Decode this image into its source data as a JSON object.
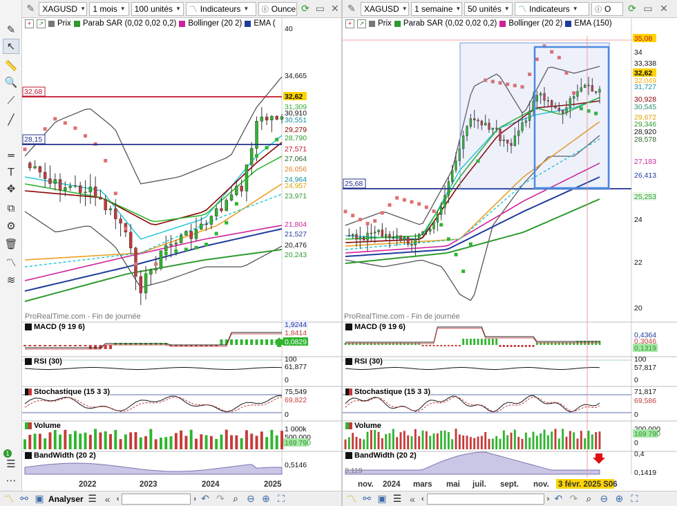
{
  "toolbar": {
    "tools": [
      "pencil-icon",
      "pointer-icon",
      "ruler-icon",
      "zoom-icon",
      "line-segment-icon",
      "trendline-icon",
      "hline-icon",
      "text-icon",
      "move-icon",
      "copy-icon",
      "settings-icon",
      "trash-icon",
      "indicator-icon",
      "fibonacci-icon"
    ],
    "badge": "1"
  },
  "left": {
    "symbol": "XAGUSD",
    "period": "1 mois",
    "units": "100 unités",
    "indicators_label": "Indicateurs",
    "unit_label": "Ounce",
    "legend": [
      "Prix",
      "Parab SAR (0,02 0,02 0,2)",
      "Bollinger (20 2)",
      "EMA ("
    ],
    "watermark": "ProRealTime.com - Fin de journée",
    "axis": [
      "40",
      "34,665",
      "32,62",
      "31,309",
      "30,910",
      "30,551",
      "29,279",
      "28,790",
      "27,571",
      "27,064",
      "26,056",
      "24,964",
      "24,957",
      "23,971",
      "21,804",
      "21,527",
      "20,476",
      "20,243"
    ],
    "hline_red": "32,68",
    "hline_blue": "28,15",
    "macd": {
      "title": "MACD (9 19 6)",
      "v1": "1,9244",
      "v2": "1,8414",
      "v3": "0,0829"
    },
    "rsi": {
      "title": "RSI (30)",
      "top": "100",
      "val": "61,877",
      "bot": "0"
    },
    "stoch": {
      "title": "Stochastique (15 3 3)",
      "v1": "75,549",
      "v2": "69,822",
      "bot": "0"
    },
    "volume": {
      "title": "Volume",
      "v1": "1 000k",
      "v2": "500 000",
      "v3": "169 790"
    },
    "bw": {
      "title": "BandWidth (20 2)",
      "val": "0,5146"
    },
    "xaxis": [
      "2022",
      "2023",
      "2024",
      "2025"
    ],
    "status": {
      "label": "Analyser"
    }
  },
  "right": {
    "symbol": "XAGUSD",
    "period": "1 semaine",
    "units": "50 unités",
    "indicators_label": "Indicateurs",
    "unit_label": "O",
    "legend": [
      "Prix",
      "Parab SAR (0,02 0,02 0,2)",
      "Bollinger (20 2)",
      "EMA (150)"
    ],
    "watermark": "ProRealTime.com - Fin de journée",
    "axis": [
      "35,08",
      "34",
      "33,338",
      "32,62",
      "32,049",
      "31,727",
      "30,928",
      "30,545",
      "29,672",
      "29,346",
      "28,920",
      "28,578",
      "27,183",
      "26,413",
      "25,253",
      "24",
      "22",
      "20"
    ],
    "hline_blue": "25,68",
    "macd": {
      "title": "MACD (9 19 6)",
      "v1": "0,4364",
      "v2": "0,3046",
      "v3": "0,1319"
    },
    "rsi": {
      "title": "RSI (30)",
      "top": "100",
      "val": "57,817",
      "bot": "0"
    },
    "stoch": {
      "title": "Stochastique (15 3 3)",
      "v1": "71,817",
      "v2": "69,586",
      "bot": "0"
    },
    "volume": {
      "title": "Volume",
      "v1": "200 000",
      "v2": "169 790",
      "v3": "0"
    },
    "bw": {
      "title": "BandWidth (20 2)",
      "v1": "0,4",
      "v2": "0,119",
      "v3": "0,1419"
    },
    "xaxis": [
      "nov.",
      "2024",
      "mars",
      "mai",
      "juil.",
      "sept.",
      "nov."
    ],
    "xaxis_current": "3 févr. 2025 S06"
  },
  "colors": {
    "bull": "#2fb52f",
    "bear": "#c63a3a",
    "sar": "#e07070",
    "boll": "#555555",
    "ema_blue": "#1f3b9a",
    "ema_green": "#2e9b2e",
    "ema_orange": "#f0a020",
    "ema_magenta": "#d0209a",
    "cyan": "#19c6d6"
  }
}
